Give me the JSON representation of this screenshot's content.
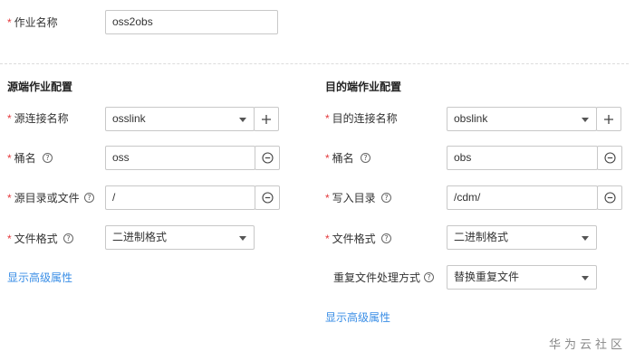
{
  "job": {
    "name_label": "作业名称",
    "name_value": "oss2obs"
  },
  "source": {
    "heading": "源端作业配置",
    "link_label": "源连接名称",
    "link_value": "osslink",
    "bucket_label": "桶名",
    "bucket_value": "oss",
    "dir_label": "源目录或文件",
    "dir_value": "/",
    "format_label": "文件格式",
    "format_value": "二进制格式",
    "advanced_link": "显示高级属性"
  },
  "target": {
    "heading": "目的端作业配置",
    "link_label": "目的连接名称",
    "link_value": "obslink",
    "bucket_label": "桶名",
    "bucket_value": "obs",
    "dir_label": "写入目录",
    "dir_value": "/cdm/",
    "format_label": "文件格式",
    "format_value": "二进制格式",
    "duplicate_label": "重复文件处理方式",
    "duplicate_value": "替换重复文件",
    "advanced_link": "显示高级属性"
  },
  "symbols": {
    "required": "*",
    "help": "?"
  },
  "watermark": "华为云社区",
  "colors": {
    "required": "#e4393c",
    "link": "#3a8ee6",
    "border": "#c8c8c8"
  }
}
